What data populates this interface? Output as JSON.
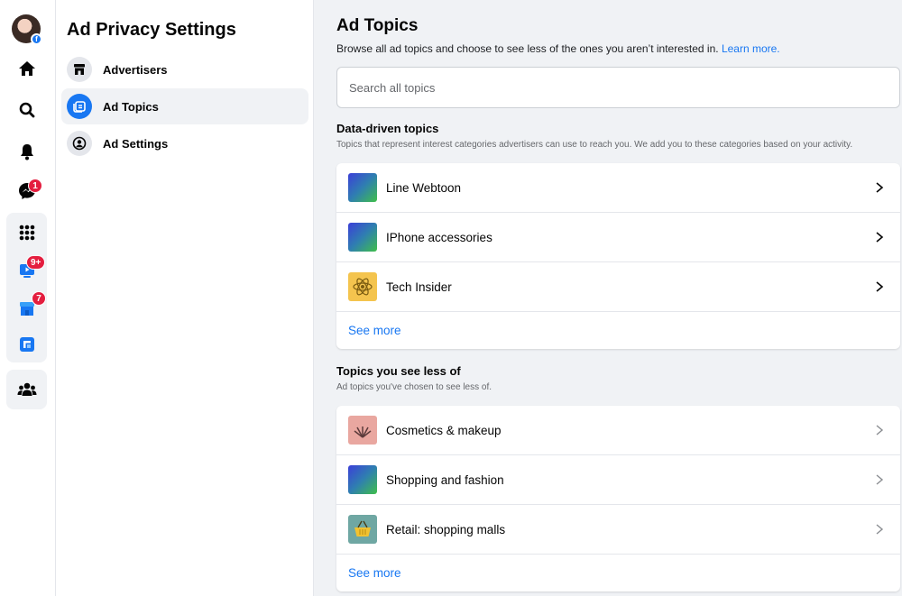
{
  "rail": {
    "messenger_badge": "1",
    "watch_badge": "9+",
    "marketplace_badge": "7",
    "fb_mark": "f"
  },
  "panel": {
    "title": "Ad Privacy Settings",
    "items": [
      {
        "label": "Advertisers",
        "icon": "storefront-icon"
      },
      {
        "label": "Ad Topics",
        "icon": "ad-topics-icon"
      },
      {
        "label": "Ad Settings",
        "icon": "user-circle-icon"
      }
    ]
  },
  "main": {
    "title": "Ad Topics",
    "intro": "Browse all ad topics and choose to see less of the ones you aren’t interested in.",
    "learn_more": "Learn more.",
    "search_placeholder": "Search all topics",
    "data_driven": {
      "title": "Data-driven topics",
      "description": "Topics that represent interest categories advertisers can use to reach you. We add you to these categories based on your activity.",
      "items": [
        {
          "label": "Line Webtoon",
          "thumb": "gradient"
        },
        {
          "label": "IPhone accessories",
          "thumb": "gradient"
        },
        {
          "label": "Tech Insider",
          "thumb": "atom-icon"
        }
      ],
      "see_more": "See more"
    },
    "see_less": {
      "title": "Topics you see less of",
      "description": "Ad topics you've chosen to see less of.",
      "items": [
        {
          "label": "Cosmetics & makeup",
          "thumb": "makeup-brush-icon"
        },
        {
          "label": "Shopping and fashion",
          "thumb": "gradient"
        },
        {
          "label": "Retail: shopping malls",
          "thumb": "shopping-basket-icon"
        }
      ],
      "see_more": "See more"
    }
  },
  "colors": {
    "accent": "#1877f2",
    "badge": "#e41e3f",
    "background": "#f0f2f5"
  }
}
